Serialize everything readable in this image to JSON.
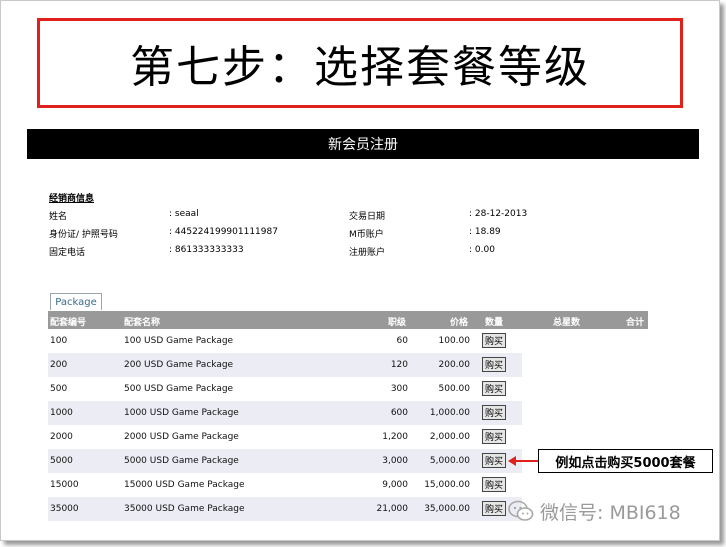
{
  "step_title": "第七步：选择套餐等级",
  "registration_bar": "新会员注册",
  "dealer_info": {
    "section_title": "经销商信息",
    "left": [
      {
        "label": "姓名",
        "value": ": seaal"
      },
      {
        "label": "身份证/ 护照号码",
        "value": ": 445224199901111987"
      },
      {
        "label": "固定电话",
        "value": ": 861333333333"
      }
    ],
    "right": [
      {
        "label": "交易日期",
        "value": ": 28-12-2013"
      },
      {
        "label": "M币账户",
        "value": ": 18.89"
      },
      {
        "label": "注册账户",
        "value": ": 0.00"
      }
    ]
  },
  "tab_label": "Package",
  "table": {
    "headers": [
      "配套编号",
      "配套名称",
      "职级",
      "价格",
      "数量",
      "总星数",
      "合计"
    ],
    "rows": [
      {
        "code": "100",
        "name": "100 USD Game Package",
        "rank": "60",
        "price": "100.00",
        "buy": "购买"
      },
      {
        "code": "200",
        "name": "200 USD Game Package",
        "rank": "120",
        "price": "200.00",
        "buy": "购买"
      },
      {
        "code": "500",
        "name": "500 USD Game Package",
        "rank": "300",
        "price": "500.00",
        "buy": "购买"
      },
      {
        "code": "1000",
        "name": "1000 USD Game Package",
        "rank": "600",
        "price": "1,000.00",
        "buy": "购买"
      },
      {
        "code": "2000",
        "name": "2000 USD Game Package",
        "rank": "1,200",
        "price": "2,000.00",
        "buy": "购买"
      },
      {
        "code": "5000",
        "name": "5000 USD Game Package",
        "rank": "3,000",
        "price": "5,000.00",
        "buy": "购买"
      },
      {
        "code": "15000",
        "name": "15000 USD Game Package",
        "rank": "9,000",
        "price": "15,000.00",
        "buy": "购买"
      },
      {
        "code": "35000",
        "name": "35000 USD Game Package",
        "rank": "21,000",
        "price": "35,000.00",
        "buy": "购买"
      }
    ]
  },
  "callout": "例如点击购买5000套餐",
  "watermark": "微信号: MBI618",
  "colors": {
    "accent_red": "#e0201a",
    "header_gray": "#999999",
    "bar_black": "#000000"
  }
}
